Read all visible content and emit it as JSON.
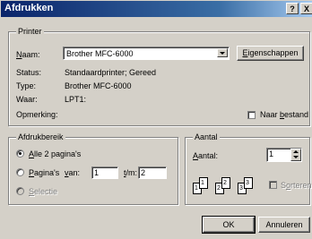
{
  "title": "Afdrukken",
  "title_buttons": {
    "help": "?",
    "close": "X"
  },
  "printer": {
    "legend": "Printer",
    "name_label": "Naam:",
    "name_value": "Brother MFC-6000",
    "properties_button": "Eigenschappen",
    "status_label": "Status:",
    "status_value": "Standaardprinter; Gereed",
    "type_label": "Type:",
    "type_value": "Brother MFC-6000",
    "where_label": "Waar:",
    "where_value": "LPT1:",
    "comment_label": "Opmerking:",
    "to_file_label": "Naar bestand"
  },
  "print_range": {
    "legend": "Afdrukbereik",
    "all_label": "Alle 2 pagina's",
    "pages_label": "Pagina's",
    "from_label": "van:",
    "from_value": "1",
    "to_label": "t/m:",
    "to_value": "2",
    "selection_label": "Selectie"
  },
  "copies": {
    "legend": "Aantal",
    "count_label": "Aantal:",
    "count_value": "1",
    "collate_label": "Sorteren",
    "collate_pages": [
      "1",
      "1",
      "2",
      "2",
      "3",
      "3"
    ]
  },
  "buttons": {
    "ok": "OK",
    "cancel": "Annuleren"
  }
}
